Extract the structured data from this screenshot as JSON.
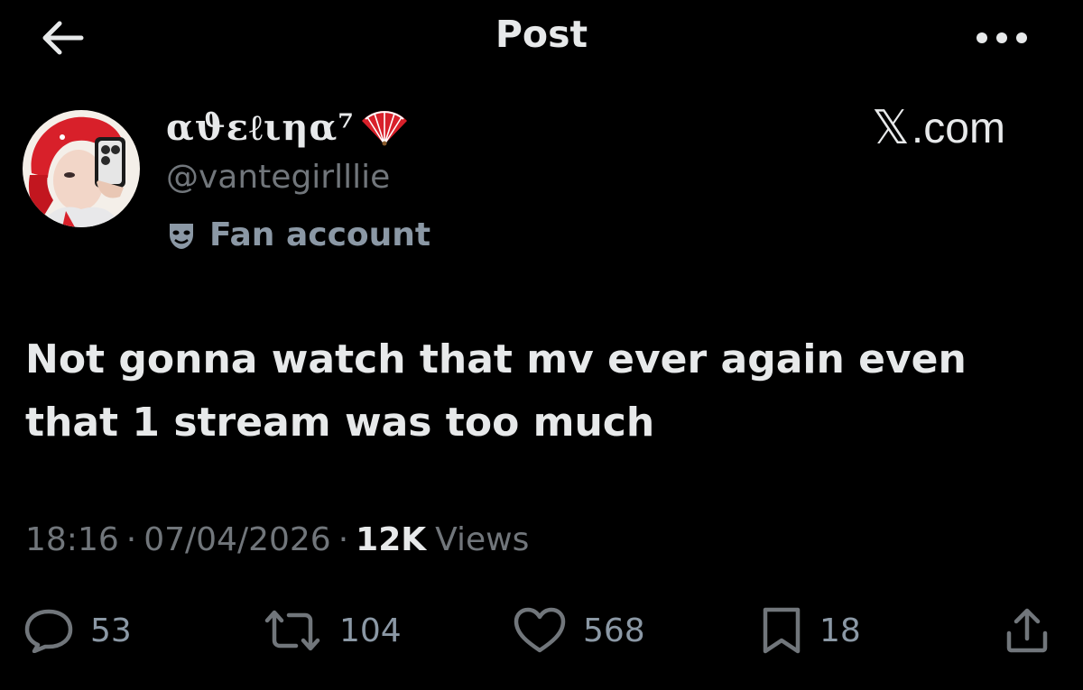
{
  "header": {
    "title": "Post",
    "back_icon": "arrow-left-icon",
    "more_icon": "more-horizontal-icon"
  },
  "author": {
    "display_name": "αϑɛℓιηα⁷",
    "name_emoji_icon": "folding-fan-icon",
    "handle": "@vantegirlllie",
    "label_icon": "performing-arts-mask-icon",
    "label": "Fan account"
  },
  "brand": {
    "x_glyph": "𝕏",
    "domain": ".com"
  },
  "post": {
    "text": "Not gonna watch that mv ever again even that 1 stream was too much"
  },
  "meta": {
    "time": "18:16",
    "separator": "·",
    "date": "07/04/2026",
    "views_count": "12K",
    "views_label": "Views"
  },
  "actions": {
    "replies": "53",
    "reposts": "104",
    "likes": "568",
    "bookmarks": "18"
  },
  "colors": {
    "background": "#000000",
    "primary_text": "#e7e9ea",
    "secondary_text": "#71767b",
    "avatar_red": "#d8202a"
  }
}
